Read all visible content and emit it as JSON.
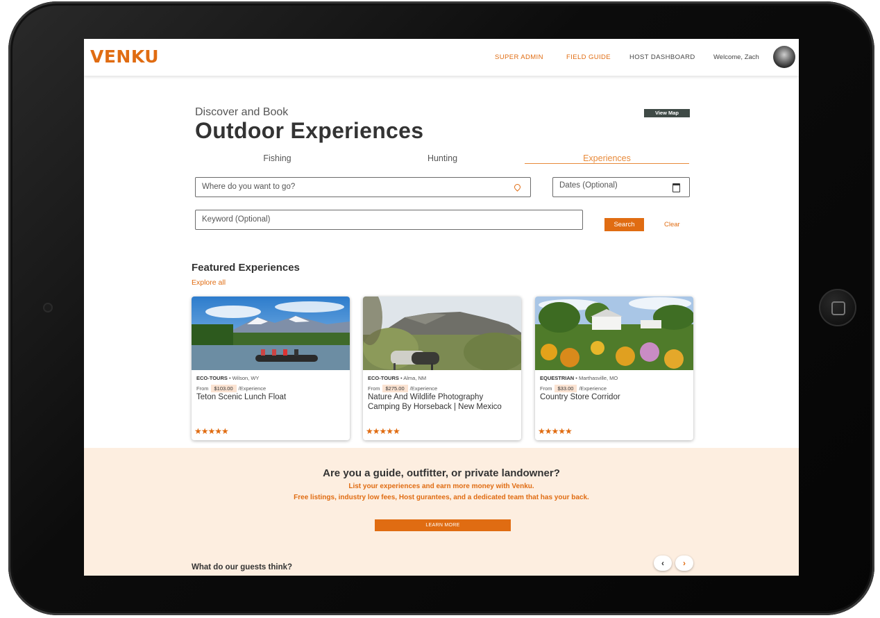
{
  "brand": {
    "name": "VENKU",
    "color": "#e06c12"
  },
  "nav": {
    "links": [
      "SUPER ADMIN",
      "FIELD GUIDE",
      "HOST DASHBOARD"
    ],
    "welcome": "Welcome, Zach"
  },
  "hero": {
    "subtitle": "Discover and Book",
    "title": "Outdoor Experiences",
    "view_map": "View Map"
  },
  "tabs": [
    {
      "label": "Fishing",
      "active": false
    },
    {
      "label": "Hunting",
      "active": false
    },
    {
      "label": "Experiences",
      "active": true
    }
  ],
  "search": {
    "location_placeholder": "Where do you want to go?",
    "dates_placeholder": "Dates (Optional)",
    "keyword_placeholder": "Keyword (Optional)",
    "search_label": "Search",
    "clear_label": "Clear"
  },
  "featured": {
    "title": "Featured Experiences",
    "explore_all": "Explore all",
    "cards": [
      {
        "category": "ECO-TOURS",
        "location": "• Wilson, WY",
        "from": "From",
        "price": "$103.00",
        "unit": "/Experience",
        "title": "Teton Scenic Lunch Float",
        "stars": "★★★★★",
        "image": "rafting-photo"
      },
      {
        "category": "ECO-TOURS",
        "location": "• Alma, NM",
        "from": "From",
        "price": "$275.00",
        "unit": "/Experience",
        "title": "Nature And Wildlife Photography Camping By Horseback | New Mexico",
        "stars": "★★★★★",
        "image": "horseback-photo"
      },
      {
        "category": "EQUESTRIAN",
        "location": "• Marthasville, MO",
        "from": "From",
        "price": "$33.00",
        "unit": "/Experience",
        "title": "Country Store Corridor",
        "stars": "★★★★★",
        "image": "farmhouse-photo"
      }
    ]
  },
  "banner": {
    "title": "Are you a guide, outfitter, or private landowner?",
    "line1": "List your experiences and earn more money with Venku.",
    "line2": "Free listings, industry low fees, Host gurantees, and a dedicated team that has your back.",
    "learn_more": "LEARN MORE",
    "guests_title": "What do our guests think?",
    "prev": "‹",
    "next": "›"
  }
}
